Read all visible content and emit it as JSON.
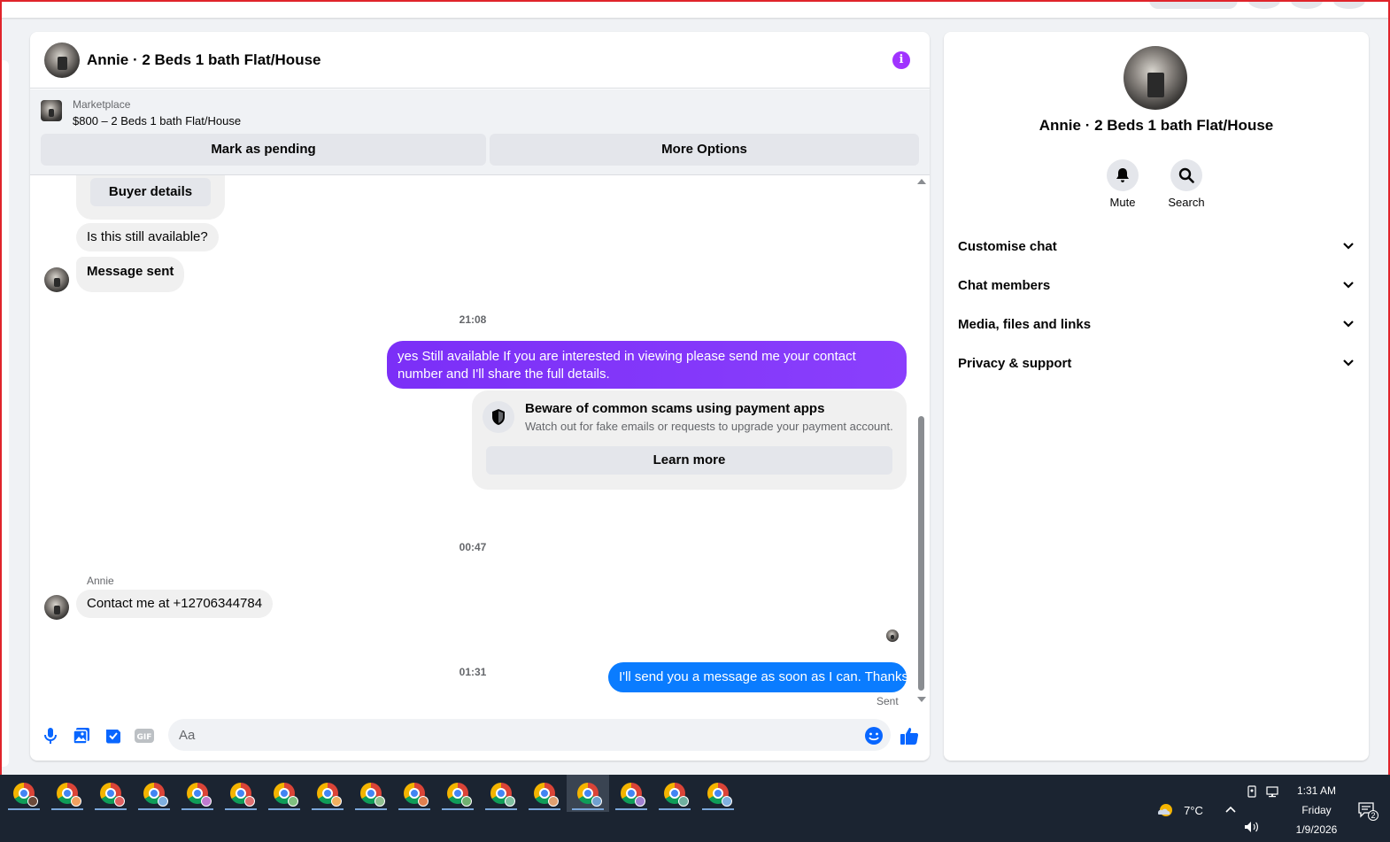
{
  "header": {
    "title": "Annie · 2 Beds 1 bath Flat/House"
  },
  "marketplace": {
    "label": "Marketplace",
    "item": "$800 – 2 Beds 1 bath Flat/House",
    "mark_pending": "Mark as pending",
    "more_options": "More Options"
  },
  "messages": {
    "buyer_details": "Buyer details",
    "still_available": "Is this still available?",
    "message_sent": "Message sent",
    "ts1": "21:08",
    "reply1": "yes Still available If you are interested in viewing please send me your contact number and I'll share the full details.",
    "scam_title": "Beware of common scams using payment apps",
    "scam_desc": "Watch out for fake emails or requests to upgrade your payment account.",
    "learn_more": "Learn more",
    "ts2": "00:47",
    "sender_name": "Annie",
    "contact": "Contact me at +12706344784",
    "ts3": "01:31",
    "reply2": "I'll send you a message as soon as I can. Thanks",
    "sent_status": "Sent"
  },
  "composer": {
    "placeholder": "Aa"
  },
  "info_panel": {
    "title": "Annie · 2 Beds 1 bath Flat/House",
    "mute": "Mute",
    "search": "Search",
    "sections": [
      "Customise chat",
      "Chat members",
      "Media, files and links",
      "Privacy & support"
    ]
  },
  "taskbar": {
    "temperature": "7°C",
    "time": "1:31 AM",
    "day": "Friday",
    "date": "1/9/2026",
    "notifications": "2"
  },
  "colors": {
    "accent_purple": "#7b2ff7",
    "accent_blue": "#0a7cff",
    "info_icon": "#a033ff"
  }
}
